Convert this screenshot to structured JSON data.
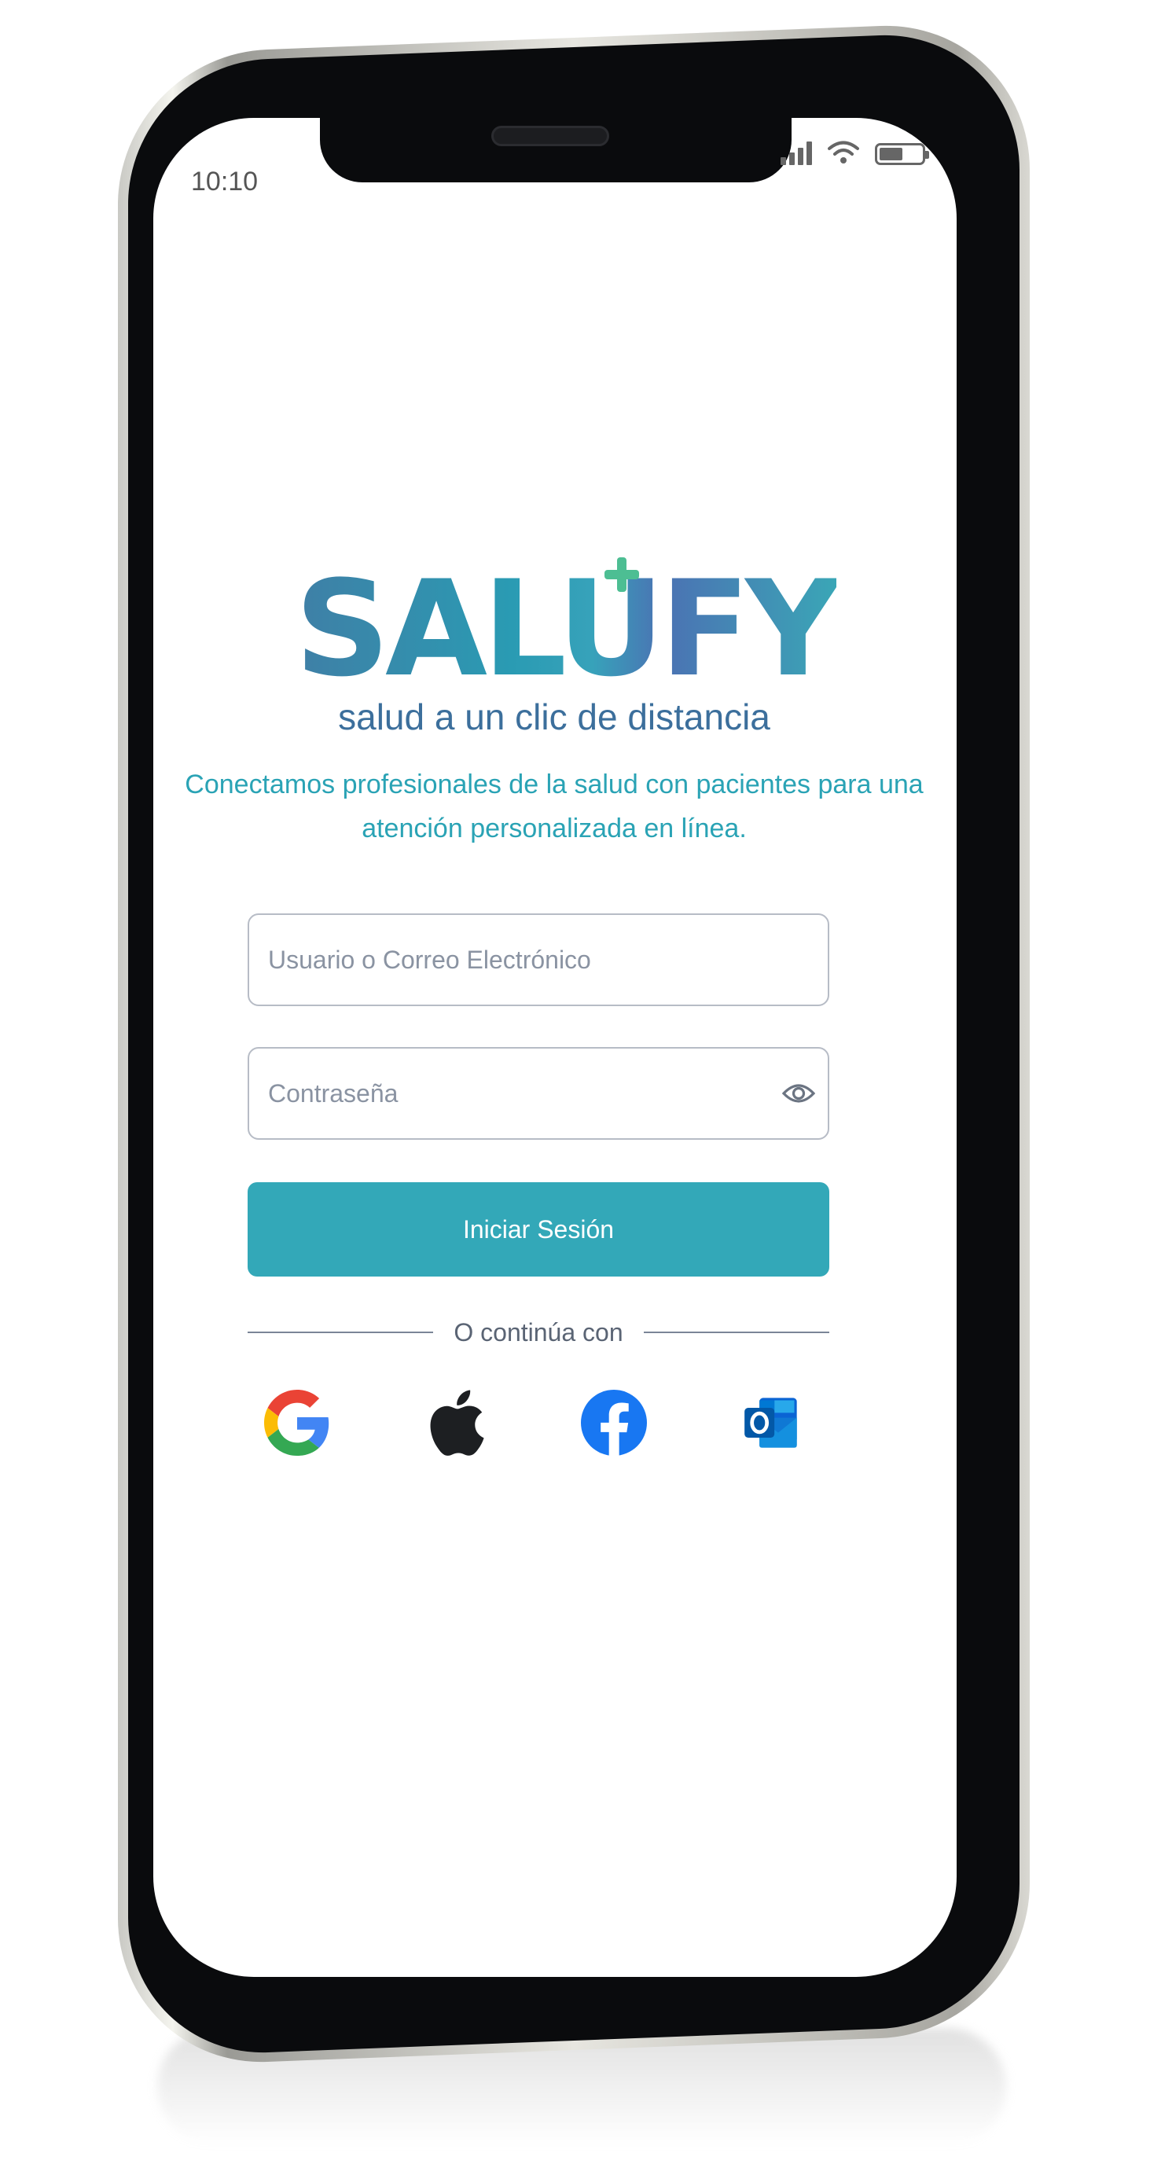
{
  "status_bar": {
    "time": "10:10",
    "battery_level": 0.55
  },
  "brand": {
    "name": "SALUFY",
    "tagline": "salud a un clic de distancia",
    "colors": {
      "primary": "#33a8b8",
      "secondary": "#3c6f9c",
      "accent": "#4dbe93"
    }
  },
  "intro_text": "Conectamos profesionales de la salud con pacientes para una atención personalizada en línea.",
  "form": {
    "username_placeholder": "Usuario o Correo Electrónico",
    "username_value": "",
    "password_placeholder": "Contraseña",
    "password_value": "",
    "submit_label": "Iniciar Sesión"
  },
  "divider_label": "O continúa con",
  "social_login": [
    {
      "provider": "Google",
      "icon": "google-icon"
    },
    {
      "provider": "Apple",
      "icon": "apple-icon"
    },
    {
      "provider": "Facebook",
      "icon": "facebook-icon"
    },
    {
      "provider": "Outlook",
      "icon": "outlook-icon"
    }
  ]
}
